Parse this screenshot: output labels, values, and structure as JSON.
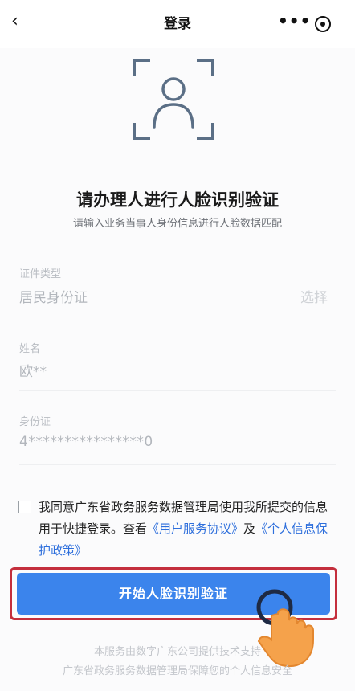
{
  "header": {
    "title": "登录",
    "back_icon": "chevron-left-icon",
    "more_icon": "more-dots-icon",
    "target_icon": "target-icon"
  },
  "face": {
    "icon": "face-frame-icon",
    "frame_color": "#5b6f86"
  },
  "main": {
    "headline": "请办理人进行人脸识别验证",
    "subline": "请输入业务当事人身份信息进行人脸数据匹配"
  },
  "form": {
    "id_type_label": "证件类型",
    "id_type_value": "居民身份证",
    "id_type_action": "选择",
    "name_label": "姓名",
    "name_value": "欧**",
    "id_label": "身份证",
    "id_value": "4****************0"
  },
  "consent": {
    "text_1": "我同意广东省政务服务数据管理局使用我所提交的信息用于快捷登录。查看",
    "link_1": "《用户服务协议》",
    "text_2": "及",
    "link_2": "《个人信息保护政策》",
    "link_color": "#2e6fdc"
  },
  "action": {
    "start_button": "开始人脸识别验证",
    "button_color": "#3b84ec",
    "highlight_color": "#c42f3d"
  },
  "footer": {
    "line_1": "本服务由数字广东公司提供技术支持",
    "line_2": "广东省政务服务数据管理局保障您的个人信息安全"
  }
}
